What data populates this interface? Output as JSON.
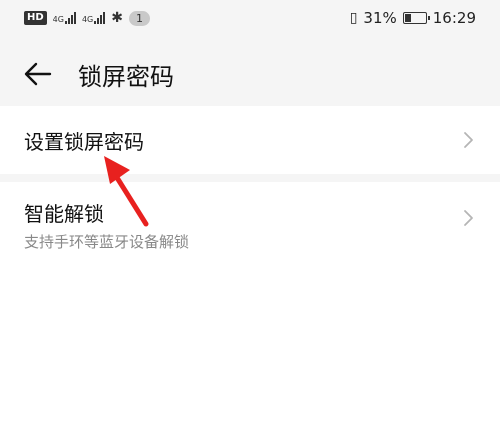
{
  "status_bar": {
    "hd": "HD",
    "net1": "4G",
    "net2": "4G",
    "notification_count": "1",
    "battery_percent": "31%",
    "battery_level": 0.31,
    "time": "16:29"
  },
  "header": {
    "title": "锁屏密码"
  },
  "items": [
    {
      "label": "设置锁屏密码"
    },
    {
      "label": "智能解锁",
      "subtitle": "支持手环等蓝牙设备解锁"
    }
  ],
  "colors": {
    "background": "#f5f5f5",
    "card": "#ffffff",
    "annotation_arrow": "#e8211f"
  }
}
